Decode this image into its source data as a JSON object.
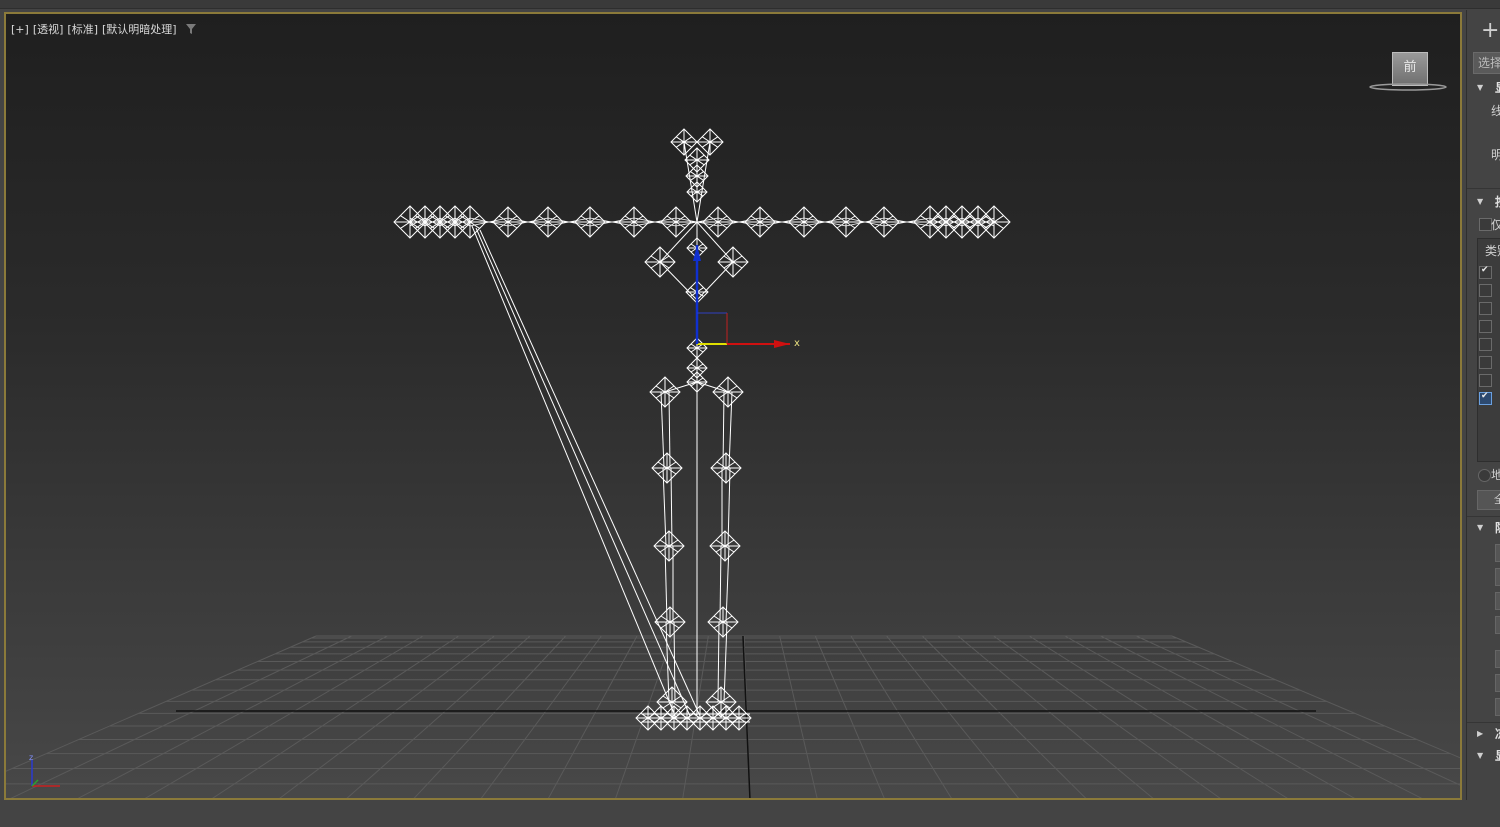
{
  "viewport": {
    "label_parts": [
      "[+]",
      "[透视]",
      "[标准]",
      "[默认明暗处理]"
    ],
    "viewcube_face": "前",
    "axis_labels": {
      "x": "x",
      "z": "z"
    },
    "filter_icon": "funnel-icon",
    "colors": {
      "border_active": "#8b7a3a",
      "axis_x": "#d01010",
      "axis_y": "#e0e000",
      "axis_z": "#1030d0",
      "wire": "#ffffff",
      "grid": "#5a5a5a"
    }
  },
  "command_panel": {
    "create_icon": "+",
    "select_button": "选择",
    "rollouts": [
      "显",
      "按",
      "隐",
      "冻",
      "显"
    ],
    "texts": [
      "线",
      "明",
      "仅",
      "类别",
      "地",
      "全"
    ],
    "checkbox_states": [
      true,
      false,
      false,
      false,
      false,
      false,
      false,
      true
    ]
  }
}
